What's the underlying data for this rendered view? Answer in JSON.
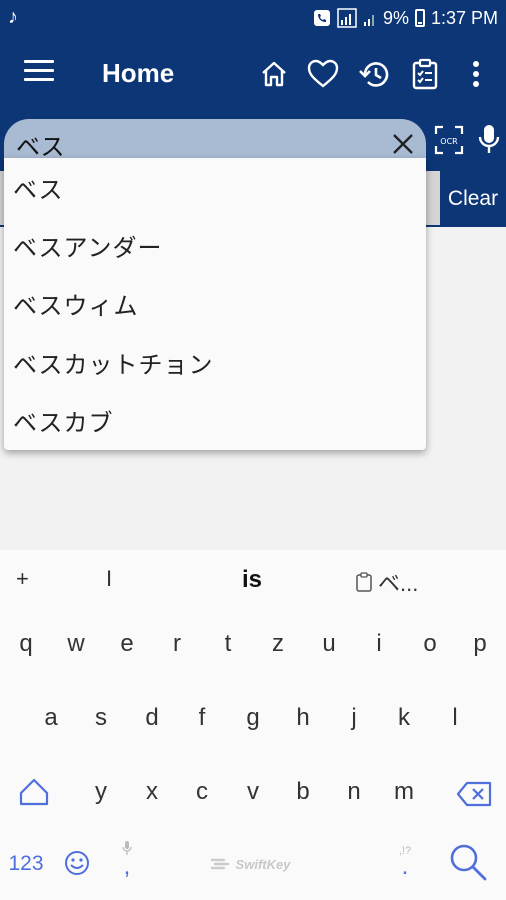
{
  "status": {
    "battery": "9%",
    "time": "1:37 PM"
  },
  "appbar": {
    "title": "Home"
  },
  "search": {
    "value": "ベス",
    "clear_label": "Clear"
  },
  "suggestions": [
    "ベス",
    "ベスアンダー",
    "ベスウィム",
    "ベスカットチョン",
    "ベスカブ"
  ],
  "keyboard": {
    "predictions": [
      "+",
      "I",
      "is",
      "ベ..."
    ],
    "row1": [
      "q",
      "w",
      "e",
      "r",
      "t",
      "z",
      "u",
      "i",
      "o",
      "p"
    ],
    "row2": [
      "a",
      "s",
      "d",
      "f",
      "g",
      "h",
      "j",
      "k",
      "l"
    ],
    "row3": [
      "y",
      "x",
      "c",
      "v",
      "b",
      "n",
      "m"
    ],
    "numbers_label": "123",
    "brand": "SwiftKey",
    "comma": ",",
    "period": ".",
    "punct_hint": ",!?"
  },
  "colors": {
    "primary": "#0d3676",
    "search_bg": "#a9bbd3",
    "keyboard_accent": "#4f6fdc"
  }
}
